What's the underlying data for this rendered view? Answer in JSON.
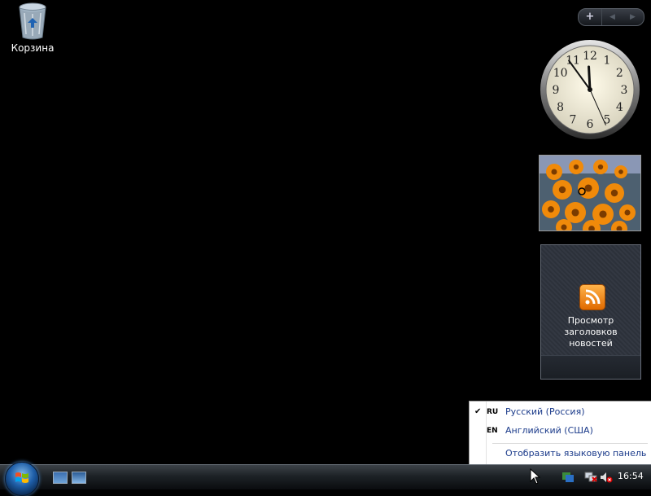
{
  "desktop": {
    "icons": [
      {
        "label": "Корзина",
        "icon": "recycle-bin-icon"
      }
    ]
  },
  "sidebar": {
    "controls": {
      "add": "+",
      "prev": "◀",
      "next": "▶"
    },
    "clock": {
      "hours": 11,
      "minutes": 54,
      "seconds": 26,
      "numerals": [
        "1",
        "2",
        "3",
        "4",
        "5",
        "6",
        "7",
        "8",
        "9",
        "10",
        "11",
        "12"
      ]
    },
    "feed_gadget": {
      "title": "Просмотр заголовков новостей",
      "icon": "rss-icon"
    }
  },
  "language_menu": {
    "items": [
      {
        "code": "RU",
        "name": "Русский (Россия)",
        "checked": true
      },
      {
        "code": "EN",
        "name": "Английский (США)",
        "checked": false
      }
    ],
    "show_bar_label": "Отобразить языковую панель"
  },
  "taskbar": {
    "time": "16:54",
    "colors": {
      "accent": "#1e5ea8"
    }
  }
}
